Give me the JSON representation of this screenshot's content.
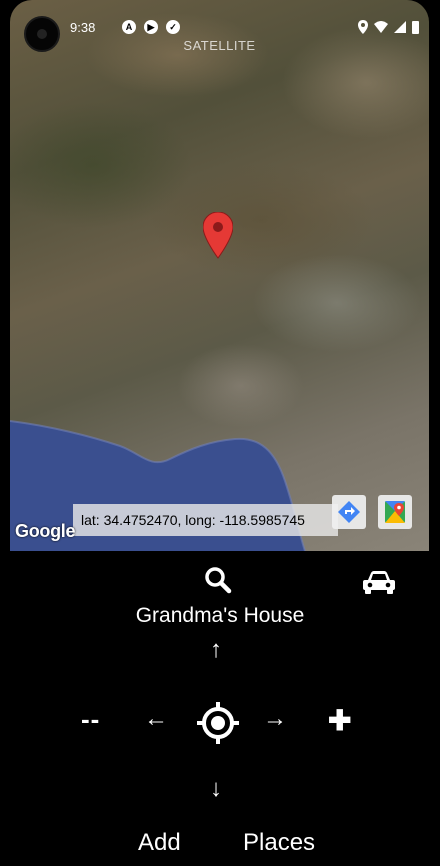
{
  "status": {
    "time": "9:38",
    "icons": [
      "notification-icon-a",
      "notification-icon-b",
      "location-icon",
      "wifi-icon",
      "signal-icon",
      "battery-icon"
    ]
  },
  "map": {
    "type_label": "SATELLITE",
    "attribution": "Google",
    "coords_text": "lat: 34.4752470, long: -118.5985745",
    "marker_color": "#e53935",
    "ocean_color": "#3a4f8f"
  },
  "controls": {
    "place_title": "Grandma's House",
    "up_arrow": "↑",
    "down_arrow": "↓",
    "left_arrow": "←",
    "right_arrow": "→",
    "zoom_out": "--",
    "zoom_in": "✚",
    "add_label": "Add",
    "places_label": "Places"
  }
}
